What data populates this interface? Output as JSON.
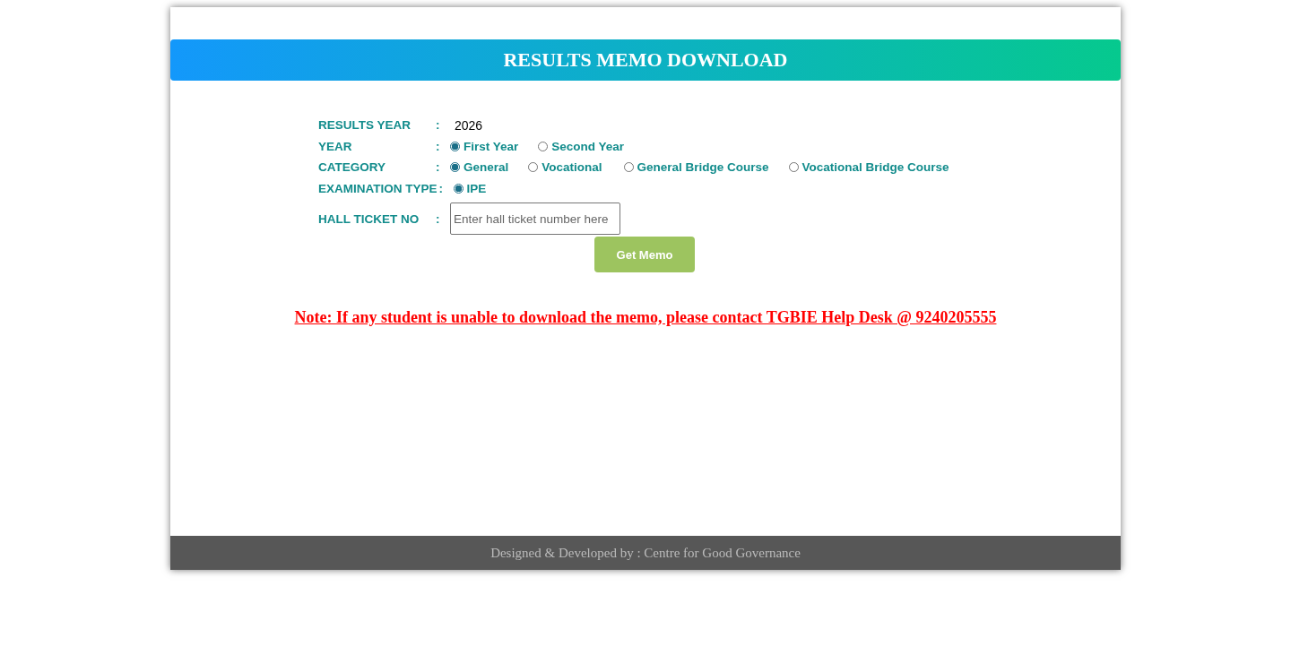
{
  "header": {
    "title": "RESULTS MEMO DOWNLOAD"
  },
  "form": {
    "rows": [
      {
        "kind": "text",
        "label": "RESULTS YEAR",
        "colon": ":",
        "value": "2026"
      },
      {
        "kind": "radio",
        "label": "YEAR",
        "colon": ":",
        "options": [
          {
            "label": "First Year",
            "selected": true
          },
          {
            "label": "Second Year",
            "selected": false
          }
        ]
      },
      {
        "kind": "radio",
        "label": "CATEGORY",
        "colon": ":",
        "options": [
          {
            "label": "General",
            "selected": true
          },
          {
            "label": "Vocational",
            "selected": false
          },
          {
            "label": "General Bridge Course",
            "selected": false
          },
          {
            "label": "Vocational Bridge Course",
            "selected": false
          }
        ]
      },
      {
        "kind": "radio",
        "label": "EXAMINATION TYPE",
        "colon": ":",
        "options": [
          {
            "label": "IPE",
            "selected": true
          }
        ]
      },
      {
        "kind": "input",
        "label": "HALL TICKET NO",
        "colon": ":",
        "placeholder": "Enter hall ticket number here"
      }
    ],
    "button": "Get Memo"
  },
  "note": "Note: If any student is unable to download the memo, please contact TGBIE Help Desk @ 9240205555",
  "footer": "Designed & Developed by : Centre for Good Governance"
}
